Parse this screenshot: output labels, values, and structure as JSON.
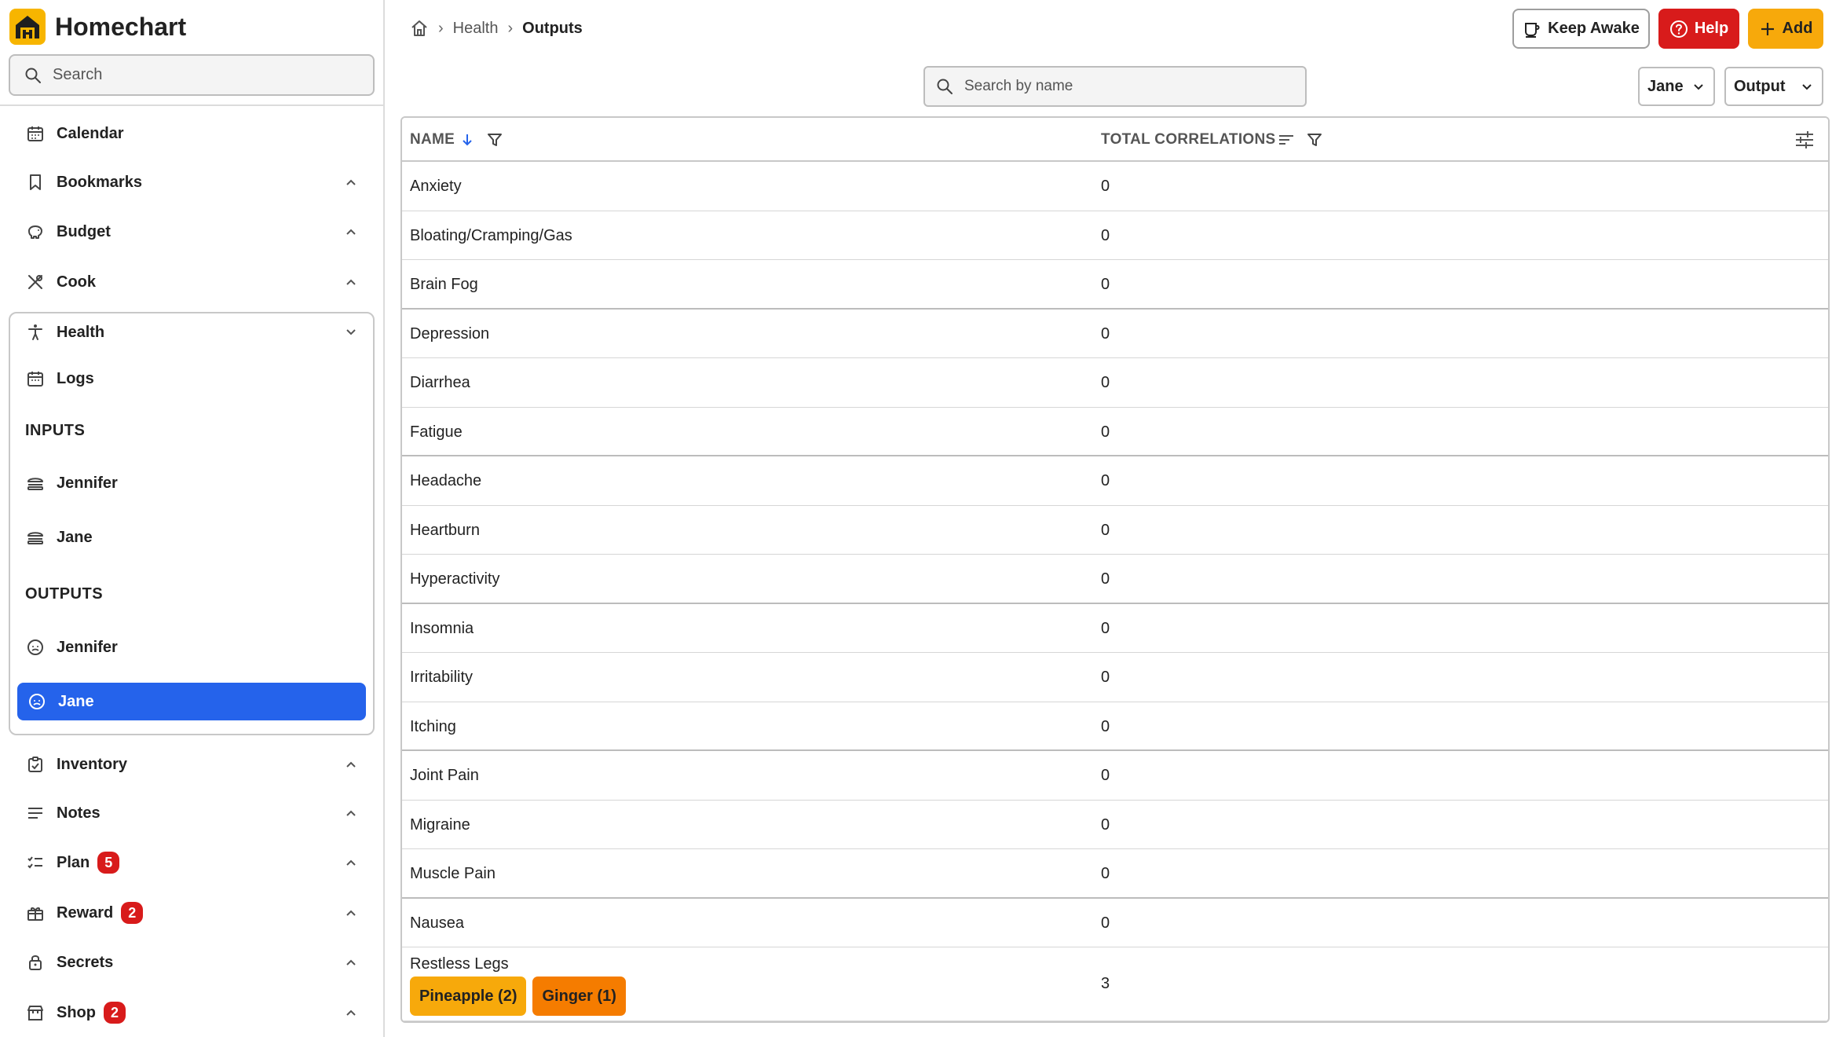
{
  "app": {
    "name": "Homechart",
    "colors": {
      "accent": "#2563eb",
      "brand": "#f7b500",
      "danger": "#d81b1b",
      "add": "#f7a90b"
    }
  },
  "sidebar": {
    "search_placeholder": "Search",
    "items": [
      {
        "key": "calendar",
        "label": "Calendar",
        "icon": "calendar-icon"
      },
      {
        "key": "bookmarks",
        "label": "Bookmarks",
        "icon": "bookmark-icon"
      },
      {
        "key": "budget",
        "label": "Budget",
        "icon": "piggy-bank-icon"
      },
      {
        "key": "cook",
        "label": "Cook",
        "icon": "utensils-icon"
      },
      {
        "key": "health",
        "label": "Health",
        "icon": "person-icon"
      }
    ],
    "health": {
      "logs_label": "Logs",
      "inputs_header": "INPUTS",
      "inputs": [
        "Jennifer",
        "Jane"
      ],
      "outputs_header": "OUTPUTS",
      "outputs": [
        "Jennifer",
        "Jane"
      ],
      "active": "Jane"
    },
    "items_after": [
      {
        "key": "inventory",
        "label": "Inventory",
        "icon": "clipboard-icon"
      },
      {
        "key": "notes",
        "label": "Notes",
        "icon": "lines-icon"
      },
      {
        "key": "plan",
        "label": "Plan",
        "icon": "checklist-icon",
        "badge": "5"
      },
      {
        "key": "reward",
        "label": "Reward",
        "icon": "gift-icon",
        "badge": "2"
      },
      {
        "key": "secrets",
        "label": "Secrets",
        "icon": "lock-icon"
      },
      {
        "key": "shop",
        "label": "Shop",
        "icon": "store-icon",
        "badge": "2"
      }
    ]
  },
  "breadcrumb": {
    "home_icon": "home-icon",
    "items": [
      "Health",
      "Outputs"
    ]
  },
  "toolbar": {
    "keep_awake": "Keep Awake",
    "help": "Help",
    "add": "Add"
  },
  "filters": {
    "search_placeholder": "Search by name",
    "person": "Jane",
    "type": "Output"
  },
  "table": {
    "columns": {
      "name": "NAME",
      "total": "TOTAL CORRELATIONS"
    },
    "rows": [
      {
        "name": "Anxiety",
        "total": "0"
      },
      {
        "name": "Bloating/Cramping/Gas",
        "total": "0"
      },
      {
        "name": "Brain Fog",
        "total": "0"
      },
      {
        "name": "Depression",
        "total": "0"
      },
      {
        "name": "Diarrhea",
        "total": "0"
      },
      {
        "name": "Fatigue",
        "total": "0"
      },
      {
        "name": "Headache",
        "total": "0"
      },
      {
        "name": "Heartburn",
        "total": "0"
      },
      {
        "name": "Hyperactivity",
        "total": "0"
      },
      {
        "name": "Insomnia",
        "total": "0"
      },
      {
        "name": "Irritability",
        "total": "0"
      },
      {
        "name": "Itching",
        "total": "0"
      },
      {
        "name": "Joint Pain",
        "total": "0"
      },
      {
        "name": "Migraine",
        "total": "0"
      },
      {
        "name": "Muscle Pain",
        "total": "0"
      },
      {
        "name": "Nausea",
        "total": "0"
      },
      {
        "name": "Restless Legs",
        "total": "3",
        "chips": [
          {
            "label": "Pineapple (2)",
            "color": "#f7a90b"
          },
          {
            "label": "Ginger (1)",
            "color": "#f57c00"
          }
        ]
      }
    ]
  }
}
